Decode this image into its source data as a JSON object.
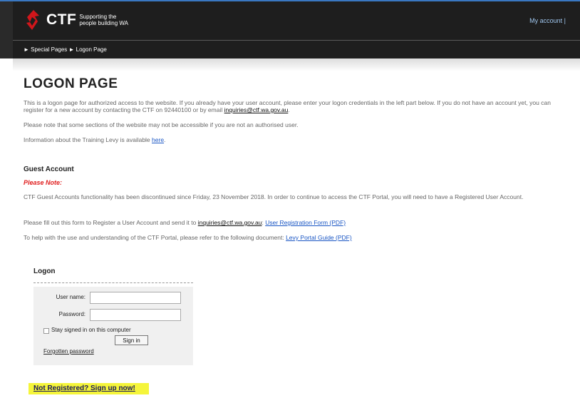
{
  "header": {
    "brand": "CTF",
    "tagline_line1": "Supporting the",
    "tagline_line2": "people building WA",
    "my_account": "My account |",
    "breadcrumb": "► Special Pages ► Logon Page",
    "colors": {
      "bar": "#1e1e1e",
      "logo_red": "#d0161b",
      "link": "#9fc6ee"
    }
  },
  "page": {
    "title": "LOGON PAGE",
    "intro_text": "This is a logon page for authorized access to the website. If you already have your user account, please enter your logon credentials in the left part below. If you do not have an account yet, you can register for a new account by contacting the CTF on 92440100 or by email ",
    "intro_email": "inquiries@ctf.wa.gov.au",
    "intro_end": ".",
    "note_text": "Please note that some sections of the website may not be accessible if you are not an authorised user.",
    "levy_text": "Information about the Training Levy is available ",
    "levy_link": "here",
    "levy_end": "."
  },
  "guest": {
    "heading": "Guest Account",
    "please_note": "Please Note:",
    "discontinued_text": "CTF Guest Accounts functionality has been discontinued since Friday, 23 November 2018. In order to continue to access the CTF Portal, you will need to have a Registered User Account.",
    "register_text": "Please fill out this form to Register a User Account and send it to ",
    "register_email": "inquiries@ctf.wa.gov.au",
    "register_sep": ": ",
    "register_link": "User Registration Form (PDF)",
    "guide_text": "To help with the use and understanding of the CTF Portal, please refer to the following document: ",
    "guide_link": "Levy Portal Guide (PDF)"
  },
  "logon": {
    "title": "Logon",
    "username_label": "User name:",
    "username_value": "",
    "password_label": "Password:",
    "password_value": "",
    "stay_signed_in": "Stay signed in on this computer",
    "stay_signed_in_checked": false,
    "sign_in": "Sign in",
    "forgotten_password": "Forgotten password"
  },
  "signup": {
    "label": "Not Registered? Sign up now!",
    "highlight_color": "#f5f53a"
  }
}
